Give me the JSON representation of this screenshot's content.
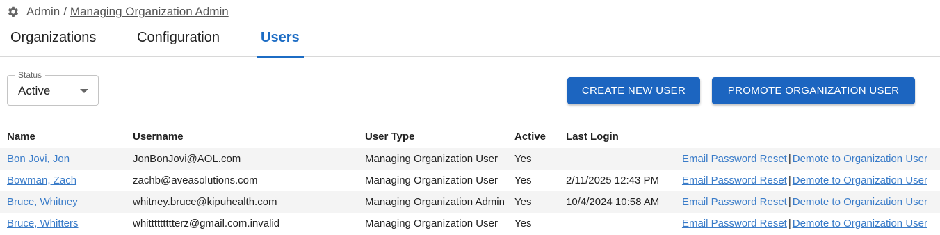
{
  "breadcrumb": {
    "root": "Admin",
    "separator": "/",
    "current": "Managing Organization Admin"
  },
  "tabs": [
    {
      "label": "Organizations",
      "active": false
    },
    {
      "label": "Configuration",
      "active": false
    },
    {
      "label": "Users",
      "active": true
    }
  ],
  "status_filter": {
    "label": "Status",
    "value": "Active"
  },
  "buttons": {
    "create": "CREATE NEW USER",
    "promote": "PROMOTE ORGANIZATION USER"
  },
  "table": {
    "headers": [
      "Name",
      "Username",
      "User Type",
      "Active",
      "Last Login"
    ],
    "action_labels": {
      "reset": "Email Password Reset",
      "separator": "|",
      "demote": "Demote to Organization User"
    },
    "rows": [
      {
        "name": "Bon Jovi, Jon",
        "username": "JonBonJovi@AOL.com",
        "user_type": "Managing Organization User",
        "active": "Yes",
        "last_login": ""
      },
      {
        "name": "Bowman, Zach",
        "username": "zachb@aveasolutions.com",
        "user_type": "Managing Organization User",
        "active": "Yes",
        "last_login": "2/11/2025 12:43 PM"
      },
      {
        "name": "Bruce, Whitney",
        "username": "whitney.bruce@kipuhealth.com",
        "user_type": "Managing Organization Admin",
        "active": "Yes",
        "last_login": "10/4/2024 10:58 AM"
      },
      {
        "name": "Bruce, Whitters",
        "username": "whittttttttterz@gmail.com.invalid",
        "user_type": "Managing Organization User",
        "active": "Yes",
        "last_login": ""
      }
    ]
  },
  "colors": {
    "accent": "#1c6cc4",
    "button": "#1c65c0",
    "link": "#3a7cc9",
    "stripe": "#f4f4f4"
  },
  "icons": {
    "breadcrumb": "gear-icon",
    "select": "chevron-down-icon"
  }
}
